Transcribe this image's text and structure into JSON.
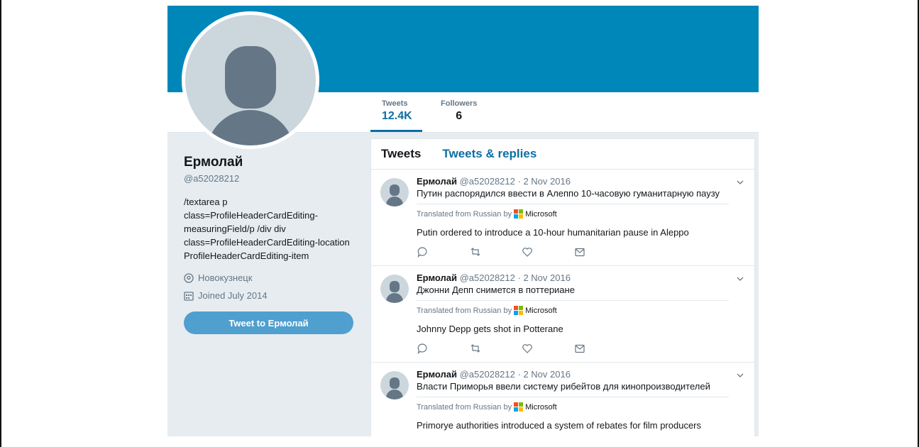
{
  "profile": {
    "name": "Ермолай",
    "handle": "@a52028212",
    "bio": "/textarea p class=ProfileHeaderCardEditing-measuringField/p /div div class=ProfileHeaderCardEditing-location ProfileHeaderCardEditing-item",
    "location": "Новокузнецк",
    "joined": "Joined July 2014",
    "tweet_to_label": "Tweet to Ермолай"
  },
  "nav": {
    "tweets_label": "Tweets",
    "tweets_value": "12.4K",
    "followers_label": "Followers",
    "followers_value": "6"
  },
  "timeline": {
    "tab_tweets": "Tweets",
    "tab_replies": "Tweets & replies"
  },
  "translated_label": "Translated from Russian by",
  "translator": "Microsoft",
  "colors": {
    "banner": "#0087ba",
    "accent": "#0b6ea3",
    "button": "#4f9fcf",
    "ms_red": "#f25022",
    "ms_green": "#7fba00",
    "ms_blue": "#00a4ef",
    "ms_yellow": "#ffb900"
  },
  "tweets": [
    {
      "name": "Ермолай",
      "handle": "@a52028212",
      "date": "· 2 Nov 2016",
      "text": "Путин распорядился ввести в Алеппо 10-часовую гуманитарную паузу",
      "translation": "Putin ordered to introduce a 10-hour humanitarian pause in Aleppo"
    },
    {
      "name": "Ермолай",
      "handle": "@a52028212",
      "date": "· 2 Nov 2016",
      "text": "Джонни Депп снимется в поттериане",
      "translation": "Johnny Depp gets shot in Potterane"
    },
    {
      "name": "Ермолай",
      "handle": "@a52028212",
      "date": "· 2 Nov 2016",
      "text": "Власти Приморья ввели систему рибейтов для кинопроизводителей",
      "translation": "Primorye authorities introduced a system of rebates for film producers"
    }
  ]
}
